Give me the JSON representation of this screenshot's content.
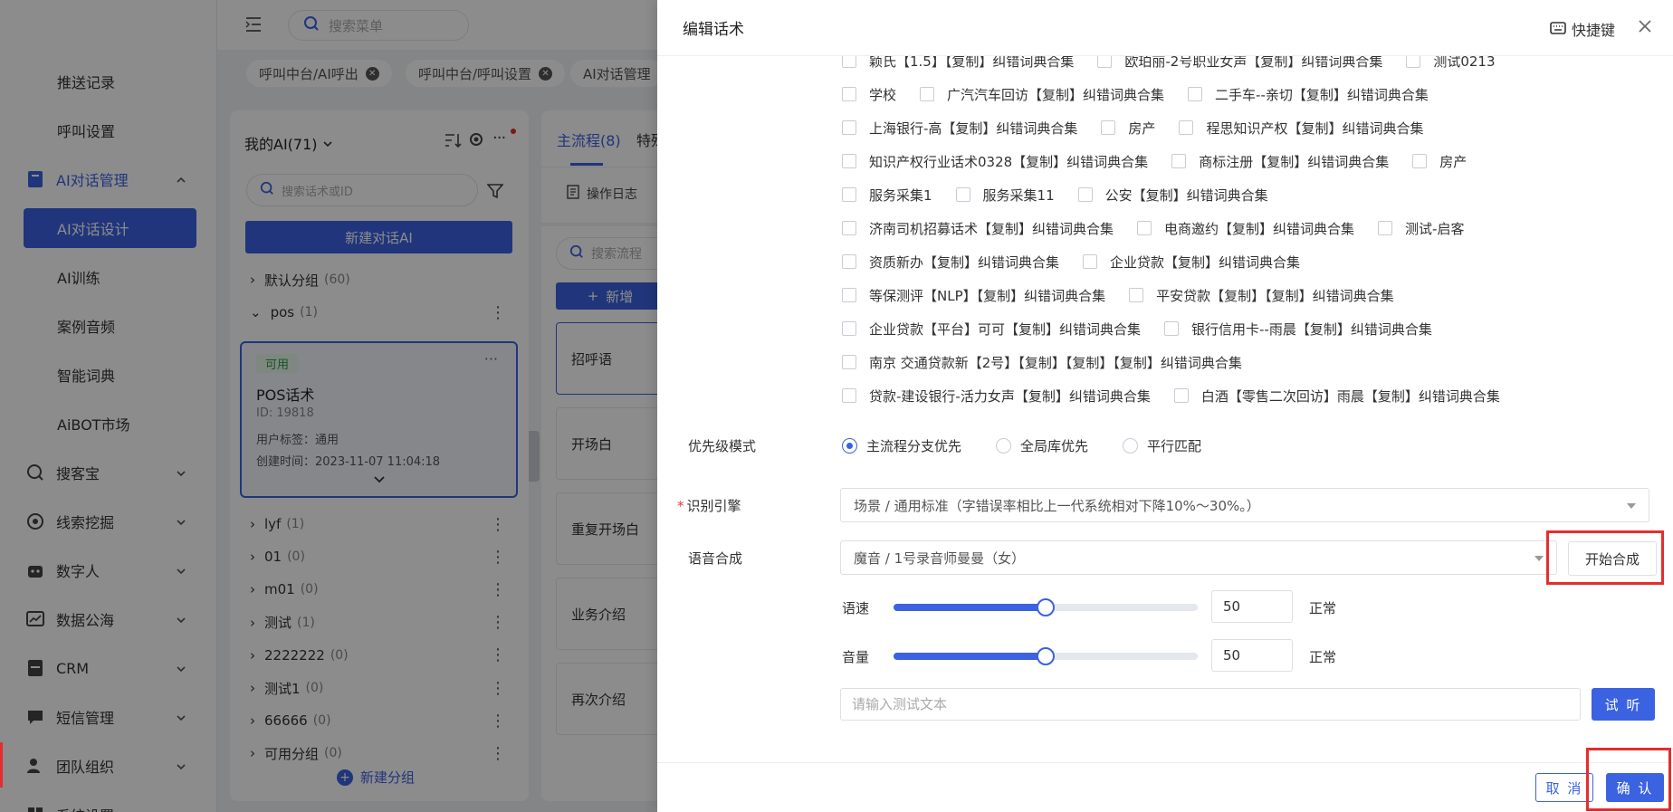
{
  "topbar": {
    "search_placeholder": "搜索菜单"
  },
  "tabs": [
    {
      "label": "呼叫中台/AI呼出"
    },
    {
      "label": "呼叫中台/呼叫设置"
    },
    {
      "label": "AI对话管理"
    }
  ],
  "sidebar": {
    "items": [
      {
        "label": "推送记录"
      },
      {
        "label": "呼叫设置"
      },
      {
        "label": "AI对话管理"
      },
      {
        "label": "AI对话设计"
      },
      {
        "label": "AI训练"
      },
      {
        "label": "案例音频"
      },
      {
        "label": "智能词典"
      },
      {
        "label": "AiBOT市场"
      },
      {
        "label": "搜客宝"
      },
      {
        "label": "线索挖掘"
      },
      {
        "label": "数字人"
      },
      {
        "label": "数据公海"
      },
      {
        "label": "CRM"
      },
      {
        "label": "短信管理"
      },
      {
        "label": "团队组织"
      },
      {
        "label": "系统设置"
      }
    ]
  },
  "ai_panel": {
    "title": "我的AI(71)",
    "search_placeholder": "搜索话术或ID",
    "new_button": "新建对话AI",
    "groups_top": [
      {
        "name": "默认分组",
        "count": "(60)"
      },
      {
        "name": "pos",
        "count": "(1)"
      }
    ],
    "card": {
      "badge": "可用",
      "name": "POS话术",
      "id": "ID: 19818",
      "tag": "用户标签：通用",
      "created": "创建时间：2023-11-07 11:04:18"
    },
    "groups": [
      {
        "name": "lyf",
        "count": "(1)"
      },
      {
        "name": "01",
        "count": "(0)"
      },
      {
        "name": "m01",
        "count": "(0)"
      },
      {
        "name": "测试",
        "count": "(1)"
      },
      {
        "name": "2222222",
        "count": "(0)"
      },
      {
        "name": "测试1",
        "count": "(0)"
      },
      {
        "name": "66666",
        "count": "(0)"
      },
      {
        "name": "可用分组",
        "count": "(0)"
      }
    ],
    "new_group": "新建分组"
  },
  "flow_panel": {
    "tab_main": "主流程(8)",
    "tab_other": "特殊",
    "log": "操作日志",
    "search_placeholder": "搜索流程",
    "add_button": "新增",
    "cards": [
      "招呼语",
      "开场白",
      "重复开场白",
      "业务介绍",
      "再次介绍"
    ]
  },
  "drawer": {
    "title": "编辑话术",
    "shortcut": "快捷键",
    "dict_rows": [
      [
        "颖氏【1.5】【复制】纠错词典合集",
        "欧珀丽-2号职业女声【复制】纠错词典合集",
        "测试0213"
      ],
      [
        "学校",
        "广汽汽车回访【复制】纠错词典合集",
        "二手车--亲切【复制】纠错词典合集"
      ],
      [
        "上海银行-高【复制】纠错词典合集",
        "房产",
        "程思知识产权【复制】纠错词典合集"
      ],
      [
        "知识产权行业话术0328【复制】纠错词典合集",
        "商标注册【复制】纠错词典合集",
        "房产"
      ],
      [
        "服务采集1",
        "服务采集11",
        "公安【复制】纠错词典合集"
      ],
      [
        "济南司机招募话术【复制】纠错词典合集",
        "电商邀约【复制】纠错词典合集",
        "测试-启客"
      ],
      [
        "资质新办【复制】纠错词典合集",
        "企业贷款【复制】纠错词典合集"
      ],
      [
        "等保测评【NLP】【复制】纠错词典合集",
        "平安贷款【复制】【复制】纠错词典合集"
      ],
      [
        "企业贷款【平台】可可【复制】纠错词典合集",
        "银行信用卡--雨晨【复制】纠错词典合集"
      ],
      [
        "南京 交通贷款新【2号】【复制】【复制】【复制】纠错词典合集"
      ],
      [
        "贷款-建设银行-活力女声【复制】纠错词典合集",
        "白酒【零售二次回访】雨晨【复制】纠错词典合集"
      ]
    ],
    "priority_label": "优先级模式",
    "priority_options": [
      "主流程分支优先",
      "全局库优先",
      "平行匹配"
    ],
    "engine_required": "*",
    "engine_label": "识别引擎",
    "engine_value": "场景 / 通用标准（字错误率相比上一代系统相对下降10%～30%。）",
    "tts_label": "语音合成",
    "tts_value": "魔音 / 1号录音师曼曼（女）",
    "synth_button": "开始合成",
    "speed_label": "语速",
    "speed_value": "50",
    "speed_desc": "正常",
    "volume_label": "音量",
    "volume_value": "50",
    "volume_desc": "正常",
    "slider_fraction": 0.5,
    "test_placeholder": "请输入测试文本",
    "listen_button": "试 听",
    "cancel_button": "取 消",
    "confirm_button": "确 认"
  },
  "colors": {
    "primary": "#3b62e0",
    "highlight": "#e52d2d",
    "badge_bg": "#e6f6e9",
    "badge_fg": "#2c9a44"
  }
}
